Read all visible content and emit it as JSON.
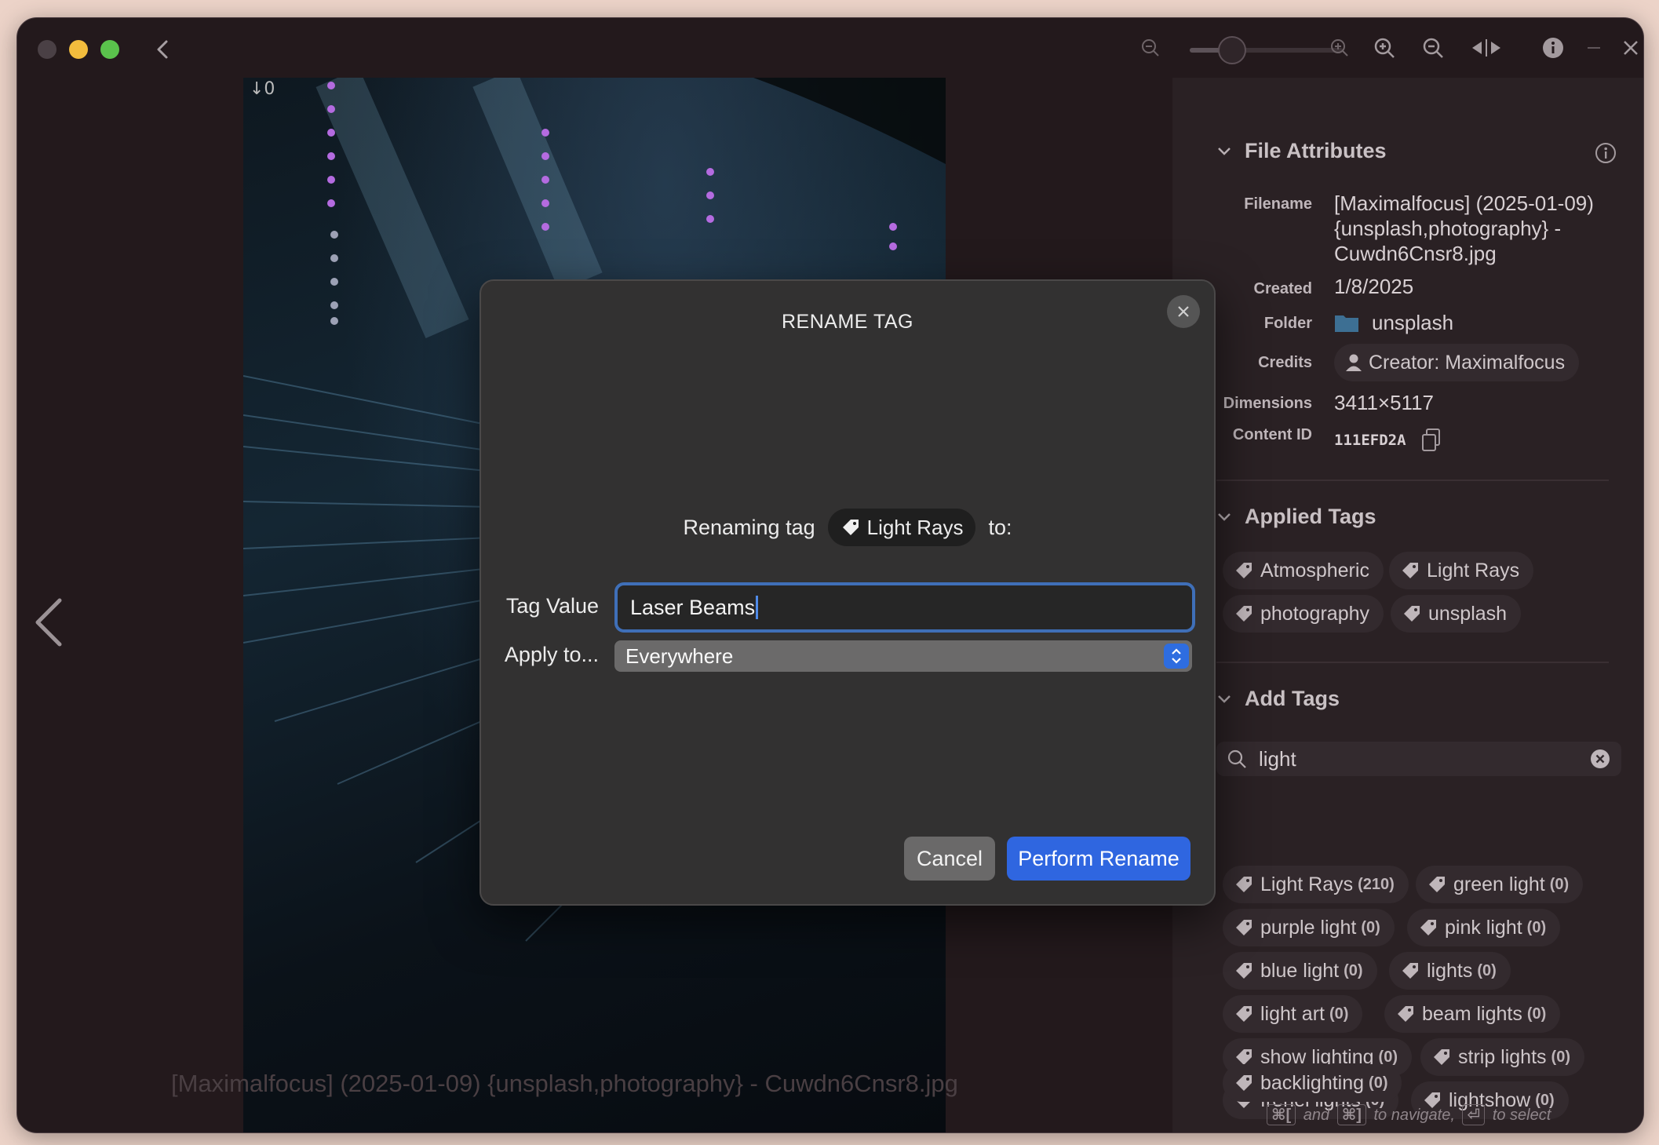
{
  "window": {
    "toolbar_icons": [
      "zoom-out-icon",
      "zoom-slider",
      "zoom-in-icon",
      "zoom-fit-icon",
      "zoom-actual-icon",
      "compare-icon",
      "info-icon",
      "minimize-icon",
      "close-icon"
    ],
    "zoom_level": 0.15
  },
  "viewer": {
    "corner_glyph": "↓0",
    "caption": "[Maximalfocus] (2025-01-09) {unsplash,photography} - Cuwdn6Cnsr8.jpg"
  },
  "file_attributes": {
    "heading": "File Attributes",
    "labels": {
      "filename": "Filename",
      "created": "Created",
      "folder": "Folder",
      "credits": "Credits",
      "dimensions": "Dimensions",
      "content_id": "Content ID"
    },
    "filename_lines": [
      "[Maximalfocus] (2025-01-09)",
      "{unsplash,photography} -",
      "Cuwdn6Cnsr8.jpg"
    ],
    "created": "1/8/2025",
    "folder": "unsplash",
    "credits": "Creator: Maximalfocus",
    "dimensions": "3411×5117",
    "content_id": "111EFD2A"
  },
  "applied_tags": {
    "heading": "Applied Tags",
    "tags": [
      "Atmospheric",
      "Light Rays",
      "photography",
      "unsplash"
    ]
  },
  "add_tags": {
    "heading": "Add Tags",
    "search_value": "light",
    "suggestions": [
      {
        "name": "Light Rays",
        "count": "(210)"
      },
      {
        "name": "green light",
        "count": "(0)"
      },
      {
        "name": "purple light",
        "count": "(0)"
      },
      {
        "name": "pink light",
        "count": "(0)"
      },
      {
        "name": "blue light",
        "count": "(0)"
      },
      {
        "name": "lights",
        "count": "(0)"
      },
      {
        "name": "light art",
        "count": "(0)"
      },
      {
        "name": "beam lights",
        "count": "(0)"
      },
      {
        "name": "show lighting",
        "count": "(0)"
      },
      {
        "name": "strip lights",
        "count": "(0)"
      },
      {
        "name": "frenel lights",
        "count": "(0)"
      },
      {
        "name": "lightshow",
        "count": "(0)"
      },
      {
        "name": "backlighting",
        "count": "(0)"
      }
    ],
    "hint": {
      "key1": "⌘[",
      "and": "and",
      "key2": "⌘]",
      "navigate": "to navigate,",
      "key3": "⏎",
      "select": "to select"
    }
  },
  "dialog": {
    "title": "RENAME TAG",
    "renaming_prefix": "Renaming tag",
    "renaming_tag": "Light Rays",
    "renaming_suffix": "to:",
    "tag_value_label": "Tag Value",
    "tag_value": "Laser Beams",
    "apply_label": "Apply to...",
    "apply_value": "Everywhere",
    "cancel_label": "Cancel",
    "confirm_label": "Perform Rename"
  },
  "colors": {
    "accent": "#2f66e0",
    "focus_ring": "#3f6fb8",
    "window_bg": "#23191c",
    "panel_bg": "#2a2124"
  }
}
